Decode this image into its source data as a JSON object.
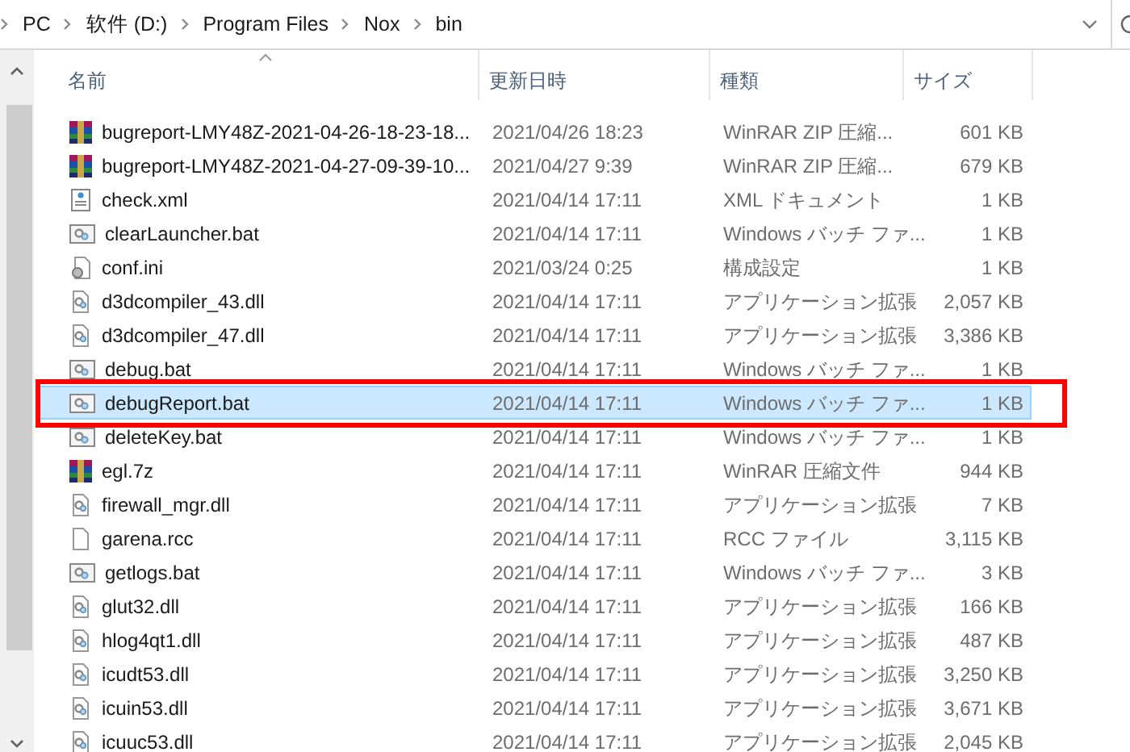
{
  "address_bar": {
    "path": [
      "PC",
      "软件 (D:)",
      "Program Files",
      "Nox",
      "bin"
    ]
  },
  "columns": [
    {
      "label": "名前",
      "sorted": true
    },
    {
      "label": "更新日時",
      "sorted": false
    },
    {
      "label": "種類",
      "sorted": false
    },
    {
      "label": "サイズ",
      "sorted": false
    }
  ],
  "rows": [
    {
      "kind": "archive",
      "name": "bugreport-LMY48Z-2021-04-26-18-23-18...",
      "date": "2021/04/26 18:23",
      "type": "WinRAR ZIP 圧縮...",
      "size": "601 KB",
      "selected": false,
      "highlighted": false
    },
    {
      "kind": "archive",
      "name": "bugreport-LMY48Z-2021-04-27-09-39-10...",
      "date": "2021/04/27 9:39",
      "type": "WinRAR ZIP 圧縮...",
      "size": "679 KB",
      "selected": false,
      "highlighted": false
    },
    {
      "kind": "xml",
      "name": "check.xml",
      "date": "2021/04/14 17:11",
      "type": "XML ドキュメント",
      "size": "1 KB",
      "selected": false,
      "highlighted": false
    },
    {
      "kind": "batch",
      "name": "clearLauncher.bat",
      "date": "2021/04/14 17:11",
      "type": "Windows バッチ ファ...",
      "size": "1 KB",
      "selected": false,
      "highlighted": false
    },
    {
      "kind": "config",
      "name": "conf.ini",
      "date": "2021/03/24 0:25",
      "type": "構成設定",
      "size": "1 KB",
      "selected": false,
      "highlighted": false
    },
    {
      "kind": "library",
      "name": "d3dcompiler_43.dll",
      "date": "2021/04/14 17:11",
      "type": "アプリケーション拡張",
      "size": "2,057 KB",
      "selected": false,
      "highlighted": false
    },
    {
      "kind": "library",
      "name": "d3dcompiler_47.dll",
      "date": "2021/04/14 17:11",
      "type": "アプリケーション拡張",
      "size": "3,386 KB",
      "selected": false,
      "highlighted": false
    },
    {
      "kind": "batch",
      "name": "debug.bat",
      "date": "2021/04/14 17:11",
      "type": "Windows バッチ ファ...",
      "size": "1 KB",
      "selected": false,
      "highlighted": false
    },
    {
      "kind": "batch",
      "name": "debugReport.bat",
      "date": "2021/04/14 17:11",
      "type": "Windows バッチ ファ...",
      "size": "1 KB",
      "selected": true,
      "highlighted": true
    },
    {
      "kind": "batch",
      "name": "deleteKey.bat",
      "date": "2021/04/14 17:11",
      "type": "Windows バッチ ファ...",
      "size": "1 KB",
      "selected": false,
      "highlighted": false
    },
    {
      "kind": "archive",
      "name": "egl.7z",
      "date": "2021/04/14 17:11",
      "type": "WinRAR 圧縮文件",
      "size": "944 KB",
      "selected": false,
      "highlighted": false
    },
    {
      "kind": "library",
      "name": "firewall_mgr.dll",
      "date": "2021/04/14 17:11",
      "type": "アプリケーション拡張",
      "size": "7 KB",
      "selected": false,
      "highlighted": false
    },
    {
      "kind": "file",
      "name": "garena.rcc",
      "date": "2021/04/14 17:11",
      "type": "RCC ファイル",
      "size": "3,115 KB",
      "selected": false,
      "highlighted": false
    },
    {
      "kind": "batch",
      "name": "getlogs.bat",
      "date": "2021/04/14 17:11",
      "type": "Windows バッチ ファ...",
      "size": "3 KB",
      "selected": false,
      "highlighted": false
    },
    {
      "kind": "library",
      "name": "glut32.dll",
      "date": "2021/04/14 17:11",
      "type": "アプリケーション拡張",
      "size": "166 KB",
      "selected": false,
      "highlighted": false
    },
    {
      "kind": "library",
      "name": "hlog4qt1.dll",
      "date": "2021/04/14 17:11",
      "type": "アプリケーション拡張",
      "size": "487 KB",
      "selected": false,
      "highlighted": false
    },
    {
      "kind": "library",
      "name": "icudt53.dll",
      "date": "2021/04/14 17:11",
      "type": "アプリケーション拡張",
      "size": "3,250 KB",
      "selected": false,
      "highlighted": false
    },
    {
      "kind": "library",
      "name": "icuin53.dll",
      "date": "2021/04/14 17:11",
      "type": "アプリケーション拡張",
      "size": "3,671 KB",
      "selected": false,
      "highlighted": false
    },
    {
      "kind": "library",
      "name": "icuuc53.dll",
      "date": "2021/04/14 17:11",
      "type": "アプリケーション拡張",
      "size": "2,045 KB",
      "selected": false,
      "highlighted": false
    }
  ]
}
